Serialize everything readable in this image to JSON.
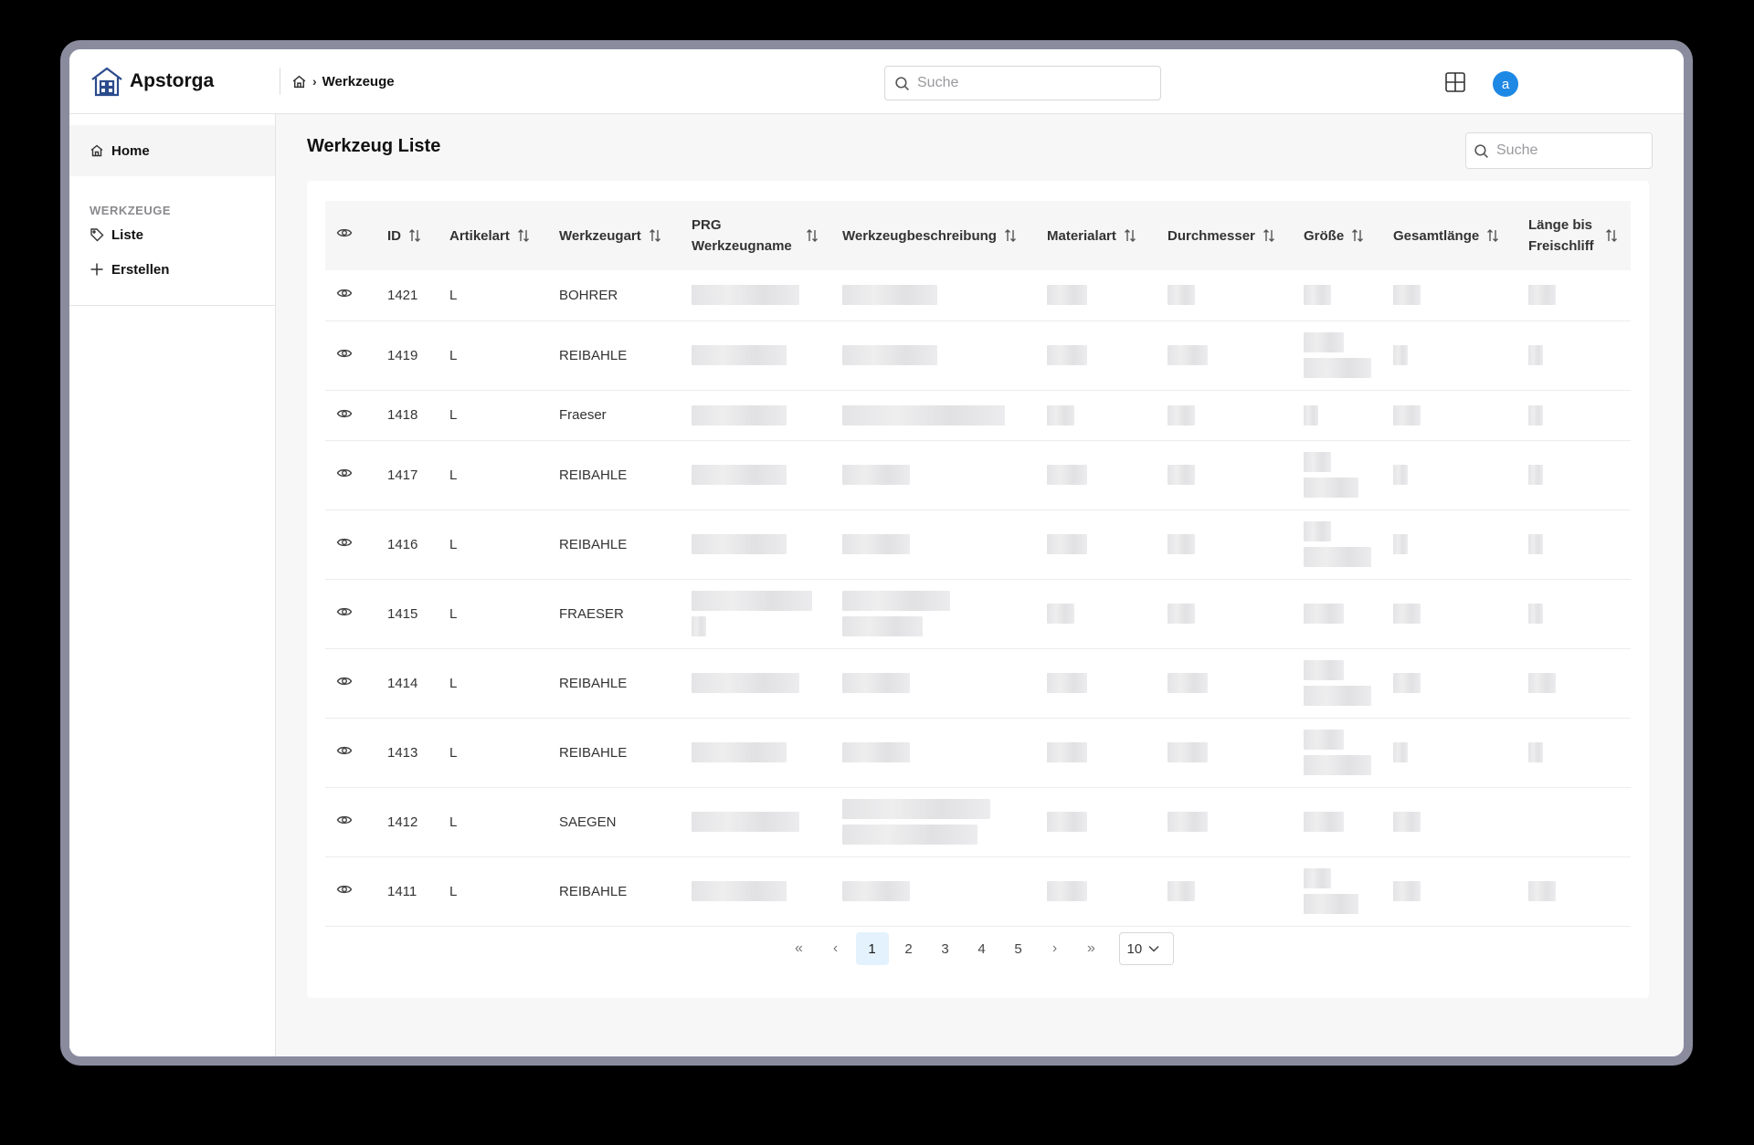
{
  "app": {
    "name": "Apstorga"
  },
  "breadcrumb": {
    "current": "Werkzeuge"
  },
  "top_search": {
    "placeholder": "Suche"
  },
  "user": {
    "avatar_letter": "a"
  },
  "sidebar": {
    "home_label": "Home",
    "section_label": "WERKZEUGE",
    "items": [
      {
        "label": "Liste"
      },
      {
        "label": "Erstellen"
      }
    ]
  },
  "page": {
    "title": "Werkzeug Liste",
    "search_placeholder": "Suche"
  },
  "table": {
    "headers": [
      "ID",
      "Artikelart",
      "Werkzeugart",
      "PRG Werkzeugname",
      "Werkzeugbeschreibung",
      "Materialart",
      "Durchmesser",
      "Größe",
      "Gesamtlänge",
      "Länge bis Freischliff"
    ],
    "rows": [
      {
        "id": "1421",
        "artikelart": "L",
        "werkzeugart": "BOHRER"
      },
      {
        "id": "1419",
        "artikelart": "L",
        "werkzeugart": "REIBAHLE"
      },
      {
        "id": "1418",
        "artikelart": "L",
        "werkzeugart": "Fraeser"
      },
      {
        "id": "1417",
        "artikelart": "L",
        "werkzeugart": "REIBAHLE"
      },
      {
        "id": "1416",
        "artikelart": "L",
        "werkzeugart": "REIBAHLE"
      },
      {
        "id": "1415",
        "artikelart": "L",
        "werkzeugart": "FRAESER"
      },
      {
        "id": "1414",
        "artikelart": "L",
        "werkzeugart": "REIBAHLE"
      },
      {
        "id": "1413",
        "artikelart": "L",
        "werkzeugart": "REIBAHLE"
      },
      {
        "id": "1412",
        "artikelart": "L",
        "werkzeugart": "SAEGEN"
      },
      {
        "id": "1411",
        "artikelart": "L",
        "werkzeugart": "REIBAHLE"
      }
    ]
  },
  "pagination": {
    "first": "«",
    "prev": "‹",
    "pages": [
      "1",
      "2",
      "3",
      "4",
      "5"
    ],
    "active_page": "1",
    "next": "›",
    "last": "»",
    "page_size": "10"
  }
}
